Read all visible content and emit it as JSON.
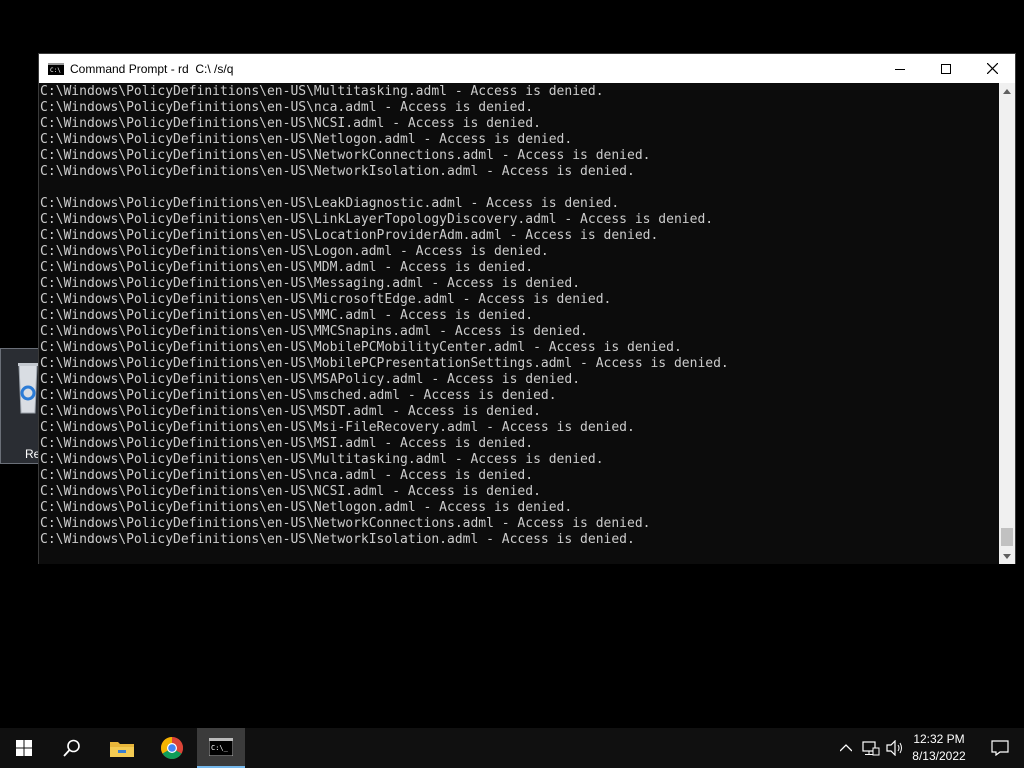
{
  "desktop": {
    "recycle_bin_label": "Re"
  },
  "window": {
    "title": "Command Prompt - rd  C:\\ /s/q",
    "icon": "cmd-icon"
  },
  "console": {
    "lines": [
      "C:\\Windows\\PolicyDefinitions\\en-US\\Multitasking.adml - Access is denied.",
      "C:\\Windows\\PolicyDefinitions\\en-US\\nca.adml - Access is denied.",
      "C:\\Windows\\PolicyDefinitions\\en-US\\NCSI.adml - Access is denied.",
      "C:\\Windows\\PolicyDefinitions\\en-US\\Netlogon.adml - Access is denied.",
      "C:\\Windows\\PolicyDefinitions\\en-US\\NetworkConnections.adml - Access is denied.",
      "C:\\Windows\\PolicyDefinitions\\en-US\\NetworkIsolation.adml - Access is denied.",
      "",
      "C:\\Windows\\PolicyDefinitions\\en-US\\LeakDiagnostic.adml - Access is denied.",
      "C:\\Windows\\PolicyDefinitions\\en-US\\LinkLayerTopologyDiscovery.adml - Access is denied.",
      "C:\\Windows\\PolicyDefinitions\\en-US\\LocationProviderAdm.adml - Access is denied.",
      "C:\\Windows\\PolicyDefinitions\\en-US\\Logon.adml - Access is denied.",
      "C:\\Windows\\PolicyDefinitions\\en-US\\MDM.adml - Access is denied.",
      "C:\\Windows\\PolicyDefinitions\\en-US\\Messaging.adml - Access is denied.",
      "C:\\Windows\\PolicyDefinitions\\en-US\\MicrosoftEdge.adml - Access is denied.",
      "C:\\Windows\\PolicyDefinitions\\en-US\\MMC.adml - Access is denied.",
      "C:\\Windows\\PolicyDefinitions\\en-US\\MMCSnapins.adml - Access is denied.",
      "C:\\Windows\\PolicyDefinitions\\en-US\\MobilePCMobilityCenter.adml - Access is denied.",
      "C:\\Windows\\PolicyDefinitions\\en-US\\MobilePCPresentationSettings.adml - Access is denied.",
      "C:\\Windows\\PolicyDefinitions\\en-US\\MSAPolicy.adml - Access is denied.",
      "C:\\Windows\\PolicyDefinitions\\en-US\\msched.adml - Access is denied.",
      "C:\\Windows\\PolicyDefinitions\\en-US\\MSDT.adml - Access is denied.",
      "C:\\Windows\\PolicyDefinitions\\en-US\\Msi-FileRecovery.adml - Access is denied.",
      "C:\\Windows\\PolicyDefinitions\\en-US\\MSI.adml - Access is denied.",
      "C:\\Windows\\PolicyDefinitions\\en-US\\Multitasking.adml - Access is denied.",
      "C:\\Windows\\PolicyDefinitions\\en-US\\nca.adml - Access is denied.",
      "C:\\Windows\\PolicyDefinitions\\en-US\\NCSI.adml - Access is denied.",
      "C:\\Windows\\PolicyDefinitions\\en-US\\Netlogon.adml - Access is denied.",
      "C:\\Windows\\PolicyDefinitions\\en-US\\NetworkConnections.adml - Access is denied.",
      "C:\\Windows\\PolicyDefinitions\\en-US\\NetworkIsolation.adml - Access is denied."
    ],
    "text_color": "#cccccc",
    "background": "#0c0c0c"
  },
  "taskbar": {
    "icons": [
      "start-icon",
      "search-icon",
      "file-explorer-icon",
      "chrome-icon",
      "command-prompt-icon"
    ],
    "active_app": "command-prompt-icon",
    "accent": "#76b9ed",
    "clock_time": "12:32 PM",
    "clock_date": "8/13/2022"
  }
}
